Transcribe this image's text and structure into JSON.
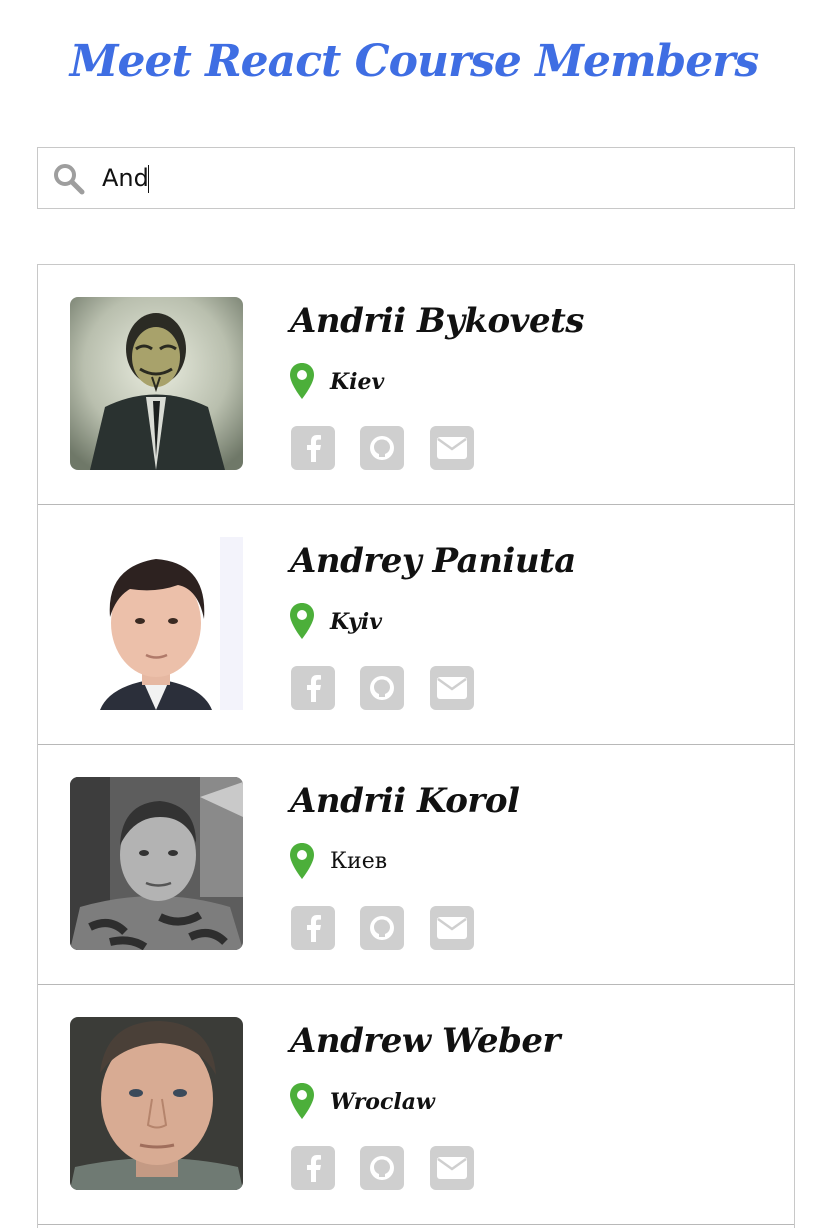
{
  "header": {
    "title": "Meet React Course Members"
  },
  "search": {
    "value": "And",
    "icon": "search-icon"
  },
  "members": [
    {
      "name": "Andrii Bykovets",
      "city": "Kiev",
      "avatar": "masked-person-photo"
    },
    {
      "name": "Andrey Paniuta",
      "city": "Kyiv",
      "avatar": "portrait-photo"
    },
    {
      "name": "Andrii Korol",
      "city": "Киев",
      "avatar": "bw-portrait-photo"
    },
    {
      "name": "Andrew Weber",
      "city": "Wroclaw",
      "avatar": "portrait-photo"
    }
  ],
  "icons": {
    "location": "map-pin-icon",
    "facebook": "facebook-icon",
    "github": "github-icon",
    "email": "envelope-icon"
  },
  "colors": {
    "title": "#3f6ee3",
    "pin": "#4caf3a",
    "social_bg": "#cfcfcf",
    "border": "#c8c8c8"
  }
}
